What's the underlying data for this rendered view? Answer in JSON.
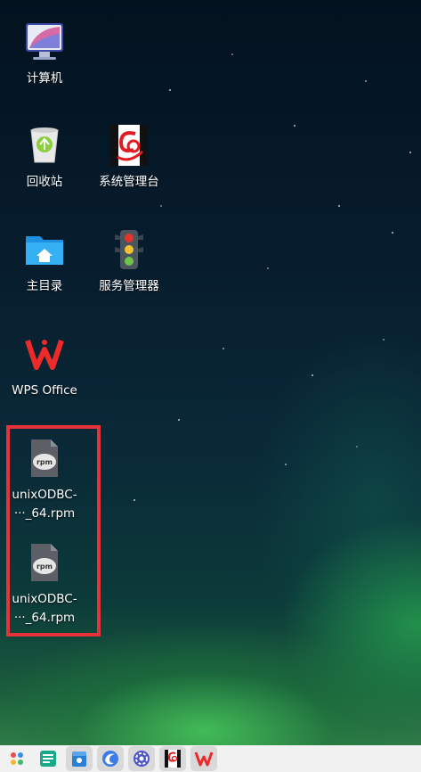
{
  "desktop": {
    "icons": {
      "computer": {
        "label": "计算机"
      },
      "recycle_bin": {
        "label": "回收站"
      },
      "system_admin": {
        "label": "系统管理台"
      },
      "home_dir": {
        "label": "主目录"
      },
      "service_manager": {
        "label": "服务管理器"
      },
      "wps_office": {
        "label": "WPS Office"
      },
      "rpm_file_1": {
        "label": "unixODBC-\n···_64.rpm"
      },
      "rpm_file_2": {
        "label": "unixODBC-\n···_64.rpm"
      }
    },
    "selection_color": "#e8323a"
  },
  "taskbar": {
    "items": [
      {
        "icon": "start-menu-icon"
      },
      {
        "icon": "multitask-view-icon"
      },
      {
        "icon": "file-manager-icon"
      },
      {
        "icon": "browser-icon"
      },
      {
        "icon": "settings-icon"
      },
      {
        "icon": "system-admin-icon"
      },
      {
        "icon": "wps-icon"
      }
    ]
  }
}
